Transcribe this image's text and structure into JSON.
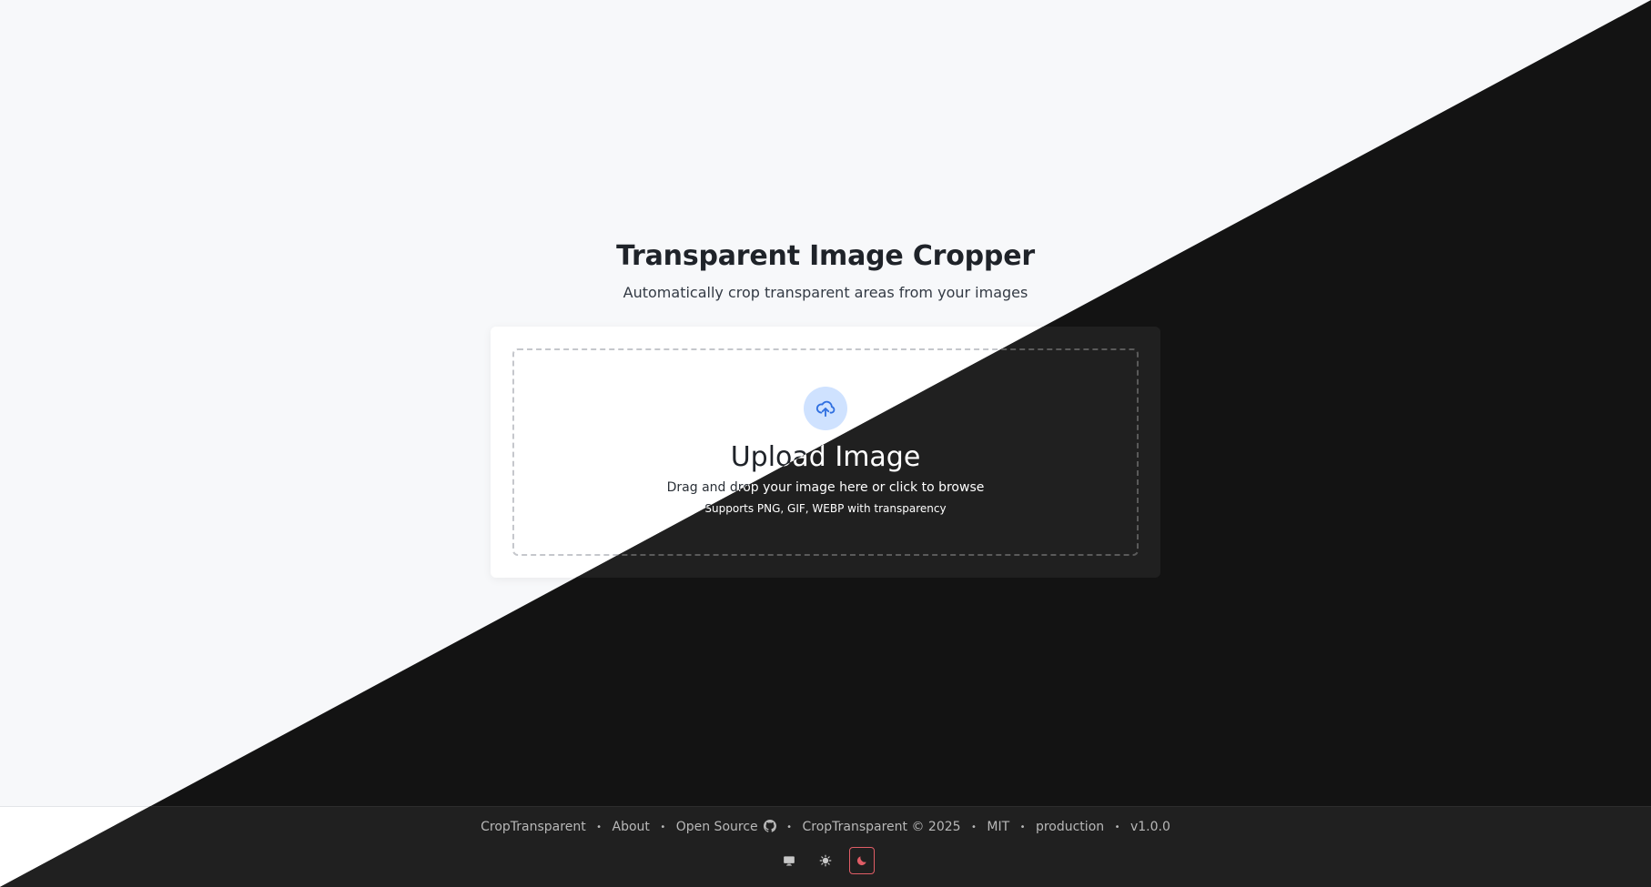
{
  "hero": {
    "title": "Transparent Image Cropper",
    "subtitle": "Automatically crop transparent areas from your images"
  },
  "upload": {
    "icon": "cloud-upload-icon",
    "title": "Upload Image",
    "description": "Drag and drop your image here or click to browse",
    "supported": "Supports PNG, GIF, WEBP with transparency"
  },
  "footer": {
    "brand": "CropTransparent",
    "about": "About",
    "open_source": "Open Source",
    "copyright": "CropTransparent © 2025",
    "license": "MIT",
    "environment": "production",
    "version": "v1.0.0",
    "separator": "•",
    "theme_buttons": [
      {
        "name": "system",
        "icon": "monitor-icon",
        "active": false
      },
      {
        "name": "light",
        "icon": "sun-icon",
        "active": false
      },
      {
        "name": "dark",
        "icon": "moon-icon",
        "active": true
      }
    ]
  },
  "colors": {
    "light_bg": "#f7f8fa",
    "dark_bg": "#131313",
    "accent_blue": "#2f6fe0",
    "icon_circle": "#cfe2ff",
    "active_border": "#e05d66"
  }
}
